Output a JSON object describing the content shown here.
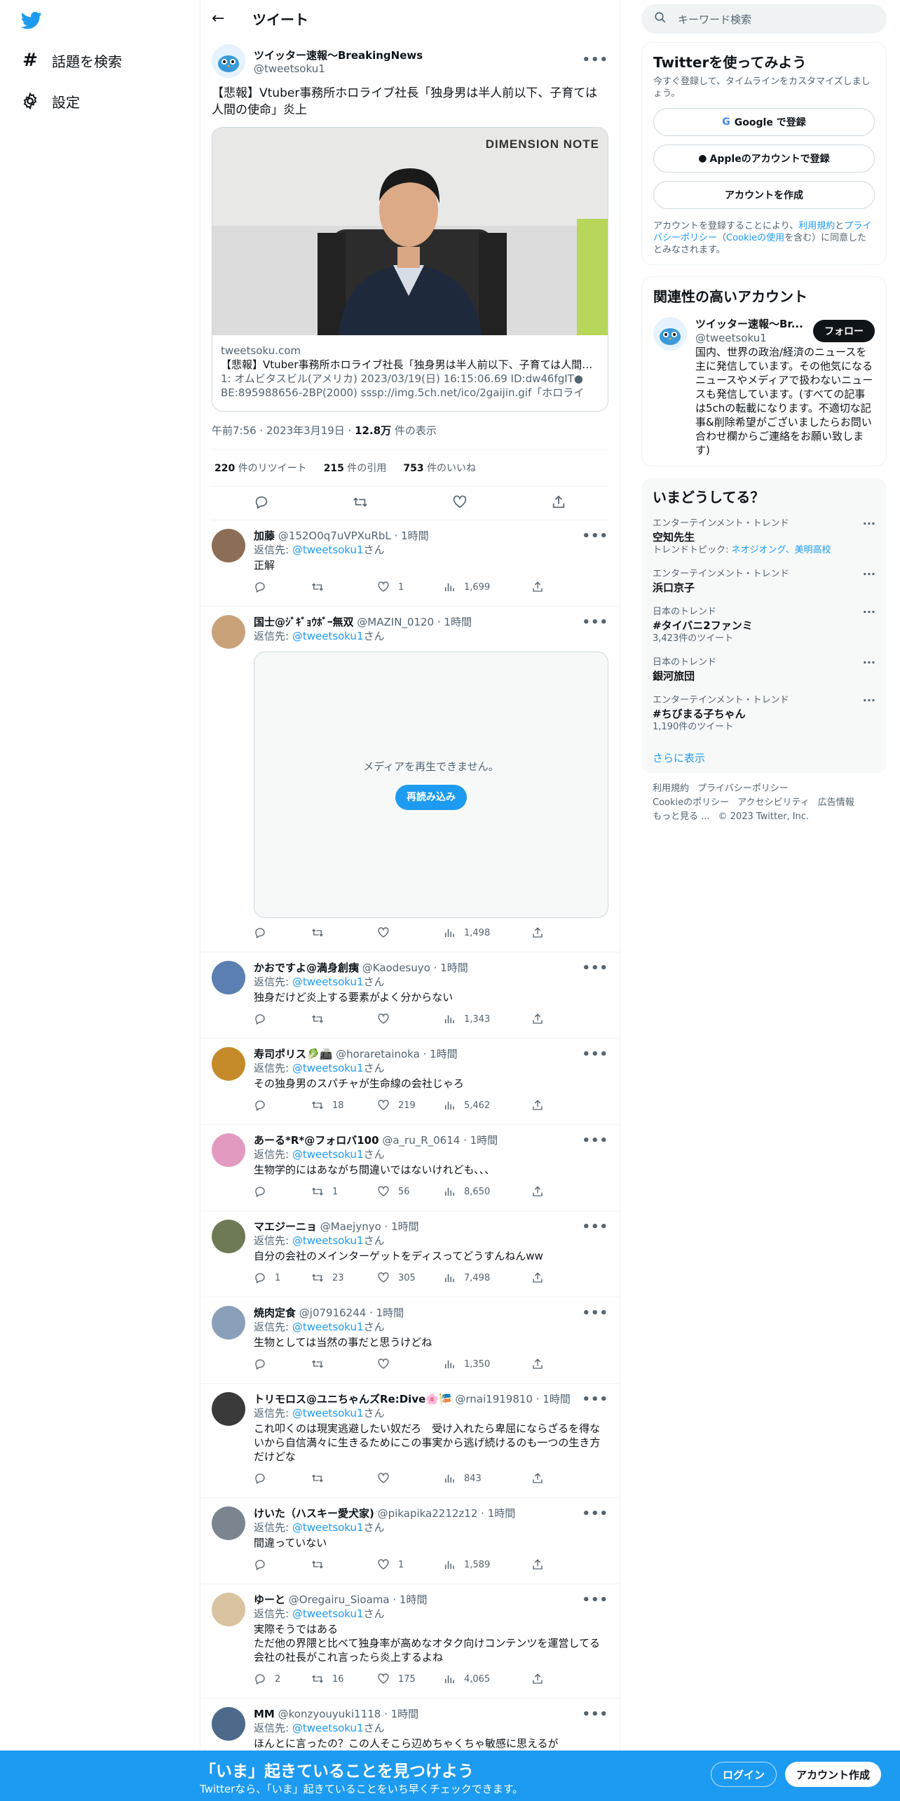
{
  "nav": {
    "explore": "話題を検索",
    "settings": "設定"
  },
  "header": {
    "title": "ツイート"
  },
  "tweet": {
    "display_name": "ツイッター速報〜BreakingNews",
    "handle": "@tweetsoku1",
    "text": "【悲報】Vtuber事務所ホロライブ社長「独身男は半人前以下、子育ては人間の使命」炎上",
    "card": {
      "watermark": "DIMENSION NOTE",
      "domain": "tweetsoku.com",
      "title": "【悲報】Vtuber事務所ホロライブ社長「独身男は半人前以下、子育ては人間の使命」炎上",
      "desc": "1: オムビタスビル(アメリカ) 2023/03/19(日) 16:15:06.69 ID:dw46fgIT● BE:895988656-2BP(2000) sssp://img.5ch.net/ico/2gaijin.gif「ホロライ"
    },
    "time": "午前7:56",
    "date": "2023年3月19日",
    "views": "12.8万",
    "views_label": "件の表示",
    "retweets": "220",
    "retweets_label": "件のリツイート",
    "quotes": "215",
    "quotes_label": "件の引用",
    "likes": "753",
    "likes_label": "件のいいね"
  },
  "replying_to_label": "返信先: ",
  "replying_to_handle": "@tweetsoku1",
  "replying_to_suffix": "さん",
  "media_error": {
    "message": "メディアを再生できません。",
    "reload": "再読み込み"
  },
  "replies": [
    {
      "name": "加藤",
      "handle": "@152O0q7uVPXuRbL",
      "time": "1時間",
      "text": "正解",
      "replies": "",
      "retweets": "",
      "likes": "1",
      "views": "1,699"
    },
    {
      "name": "国士@ｼﾞｷﾞｮｳﾎﾞｰ無双",
      "handle": "@MAZIN_0120",
      "time": "1時間",
      "text": "",
      "replies": "",
      "retweets": "",
      "likes": "",
      "views": "1,498"
    },
    {
      "name": "かおですよ@満身創痍",
      "handle": "@Kaodesuyo",
      "time": "1時間",
      "text": "独身だけど炎上する要素がよく分からない",
      "replies": "",
      "retweets": "",
      "likes": "",
      "views": "1,343"
    },
    {
      "name": "寿司ポリス🥬📠",
      "handle": "@horaretainoka",
      "time": "1時間",
      "text": "その独身男のスパチャが生命線の会社じゃろ",
      "replies": "",
      "retweets": "18",
      "likes": "219",
      "views": "5,462"
    },
    {
      "name": "あーる*R*@フォロバ100",
      "handle": "@a_ru_R_0614",
      "time": "1時間",
      "text": "生物学的にはあながち間違いではないけれども、、、",
      "replies": "",
      "retweets": "1",
      "likes": "56",
      "views": "8,650"
    },
    {
      "name": "マエジーニョ",
      "handle": "@Maejynyo",
      "time": "1時間",
      "text": "自分の会社のメインターゲットをディスってどうすんねんww",
      "replies": "1",
      "retweets": "23",
      "likes": "305",
      "views": "7,498"
    },
    {
      "name": "焼肉定食",
      "handle": "@j07916244",
      "time": "1時間",
      "text": "生物としては当然の事だと思うけどね",
      "replies": "",
      "retweets": "",
      "likes": "",
      "views": "1,350"
    },
    {
      "name": "トリモロス@ユニちゃんズRe:Dive🌸🎏",
      "handle": "@rnai1919810",
      "time": "1時間",
      "text": "これ叩くのは現実逃避したい奴だろ　受け入れたら卑屈にならざるを得ないから自信満々に生きるためにこの事実から逃げ続けるのも一つの生き方だけどな",
      "replies": "",
      "retweets": "",
      "likes": "",
      "views": "843"
    },
    {
      "name": "けいた（ハスキー愛犬家)",
      "handle": "@pikapika2212z12",
      "time": "1時間",
      "text": "間違っていない",
      "replies": "",
      "retweets": "",
      "likes": "1",
      "views": "1,589"
    },
    {
      "name": "ゆーと",
      "handle": "@Oregairu_Sioama",
      "time": "1時間",
      "text": "実際そうではある\nただ他の界隈と比べて独身率が高めなオタク向けコンテンツを運営してる会社の社長がこれ言ったら炎上するよね",
      "replies": "2",
      "retweets": "16",
      "likes": "175",
      "views": "4,065"
    },
    {
      "name": "MM",
      "handle": "@konzyouyuki1118",
      "time": "1時間",
      "text": "ほんとに言ったの？この人そこら辺めちゃくちゃ敏感に思えるが",
      "replies": "",
      "retweets": "",
      "likes": "",
      "views": ""
    }
  ],
  "right": {
    "search_placeholder": "キーワード検索",
    "signup": {
      "title": "Twitterを使ってみよう",
      "sub": "今すぐ登録して、タイムラインをカスタマイズしましょう。",
      "google": "Google で登録",
      "apple": "Appleのアカウントで登録",
      "create": "アカウントを作成",
      "legal_1": "アカウントを登録することにより、",
      "legal_terms": "利用規約",
      "legal_2": "と",
      "legal_privacy": "プライバシーポリシー",
      "legal_3": "（",
      "legal_cookie": "Cookieの使用",
      "legal_4": "を含む）に同意したとみなされます。"
    },
    "related": {
      "title": "関連性の高いアカウント",
      "name": "ツイッター速報〜Br...",
      "handle": "@tweetsoku1",
      "follow": "フォロー",
      "bio": "国内、世界の政治/経済のニュースを主に発信しています。その他気になるニュースやメディアで扱わないニュースも発信しています。(すべての記事は5chの転載になります。不適切な記事&削除希望がございましたらお問い合わせ欄からご連絡をお願い致します)"
    },
    "trends": {
      "title": "いまどうしてる？",
      "items": [
        {
          "context": "エンターテインメント・トレンド",
          "name": "空知先生",
          "extra_prefix": "トレンドトピック: ",
          "extra_links": "ネオジオング、美明高校",
          "extra": ""
        },
        {
          "context": "エンターテインメント・トレンド",
          "name": "浜口京子",
          "extra_prefix": "",
          "extra_links": "",
          "extra": ""
        },
        {
          "context": "日本のトレンド",
          "name": "#タイバニ2ファンミ",
          "extra_prefix": "",
          "extra_links": "",
          "extra": "3,423件のツイート"
        },
        {
          "context": "日本のトレンド",
          "name": "銀河旅団",
          "extra_prefix": "",
          "extra_links": "",
          "extra": ""
        },
        {
          "context": "エンターテインメント・トレンド",
          "name": "#ちびまる子ちゃん",
          "extra_prefix": "",
          "extra_links": "",
          "extra": "1,190件のツイート"
        }
      ],
      "show_more": "さらに表示"
    },
    "footer": {
      "terms": "利用規約",
      "privacy": "プライバシーポリシー",
      "cookie": "Cookieのポリシー",
      "accessibility": "アクセシビリティ",
      "ads": "広告情報",
      "more": "もっと見る ...",
      "copyright": "© 2023 Twitter, Inc."
    }
  },
  "banner": {
    "title": "「いま」起きていることを見つけよう",
    "sub": "Twitterなら、「いま」起きていることをいち早くチェックできます。",
    "login": "ログイン",
    "signup": "アカウント作成"
  },
  "colors": {
    "accent": "#1d9bf0",
    "text": "#0f1419",
    "muted": "#536471"
  }
}
